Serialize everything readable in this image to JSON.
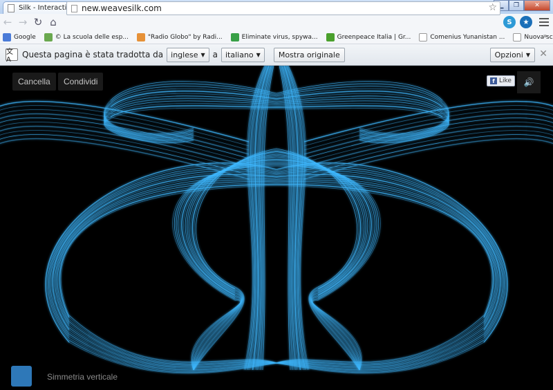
{
  "browser": {
    "tab_title": "Silk - Interactive arte genera",
    "url": "new.weavesilk.com",
    "bookmarks": [
      {
        "label": "Google",
        "icon": "google-icon",
        "color": "#4a7bd8"
      },
      {
        "label": "© La scuola delle esp...",
        "icon": "school-icon",
        "color": "#6aa84f"
      },
      {
        "label": "\"Radio Globo\" by Radi...",
        "icon": "radio-icon",
        "color": "#e69138"
      },
      {
        "label": "Eliminate virus, spywa...",
        "icon": "shield-icon",
        "color": "#38a047"
      },
      {
        "label": "Greenpeace Italia | Gr...",
        "icon": "greenpeace-icon",
        "color": "#4aa02c"
      },
      {
        "label": "Comenius Yunanistan ...",
        "icon": "page-icon",
        "color": "#ffffff"
      },
      {
        "label": "Nuova scheda",
        "icon": "page-icon",
        "color": "#ffffff"
      }
    ]
  },
  "translate_bar": {
    "message": "Questa pagina è stata tradotta da",
    "from_lang": "inglese",
    "connector": "a",
    "to_lang": "italiano",
    "show_original": "Mostra originale",
    "options": "Opzioni"
  },
  "silk": {
    "clear": "Cancella",
    "share": "Condividi",
    "like": "Like",
    "symmetry": "Simmetria verticale",
    "color": "#2e78b8"
  }
}
